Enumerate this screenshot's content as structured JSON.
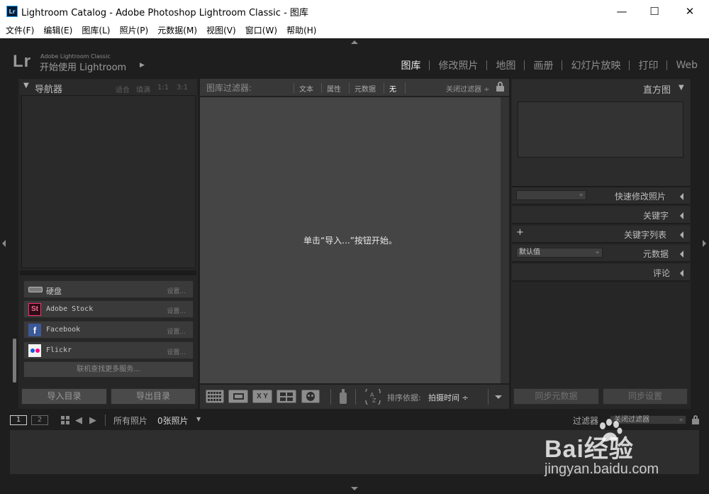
{
  "window": {
    "title": "Lightroom Catalog - Adobe Photoshop Lightroom Classic - 图库",
    "app_icon_text": "Lr",
    "minimize": "—",
    "maximize": "☐",
    "close": "✕"
  },
  "menu": [
    "文件(F)",
    "编辑(E)",
    "图库(L)",
    "照片(P)",
    "元数据(M)",
    "视图(V)",
    "窗口(W)",
    "帮助(H)"
  ],
  "identity": {
    "logo": "Lr",
    "brand_line": "Adobe Lightroom Classic",
    "get_started": "开始使用 Lightroom",
    "arrow": "▶"
  },
  "modules": [
    {
      "label": "图库",
      "active": true
    },
    {
      "label": "修改照片",
      "active": false
    },
    {
      "label": "地图",
      "active": false
    },
    {
      "label": "画册",
      "active": false
    },
    {
      "label": "幻灯片放映",
      "active": false
    },
    {
      "label": "打印",
      "active": false
    },
    {
      "label": "Web",
      "active": false
    }
  ],
  "navigator": {
    "title": "导航器",
    "toggle": "▼",
    "zoom": [
      "适合",
      "填满",
      "1:1",
      "3:1"
    ]
  },
  "publish_services": [
    {
      "name": "硬盘",
      "icon": "hard-drive-icon",
      "action": "设置..."
    },
    {
      "name": "Adobe Stock",
      "icon": "adobe-stock-icon",
      "icon_text": "St",
      "action": "设置..."
    },
    {
      "name": "Facebook",
      "icon": "facebook-icon",
      "icon_text": "f",
      "action": "设置..."
    },
    {
      "name": "Flickr",
      "icon": "flickr-icon",
      "action": "设置..."
    }
  ],
  "find_more_services": "联机查找更多服务...",
  "import_button": "导入目录",
  "export_button": "导出目录",
  "filter_bar": {
    "label": "图库过滤器:",
    "text": "文本",
    "attribute": "属性",
    "metadata": "元数据",
    "none": "无",
    "filters_off": "关闭过滤器 ÷"
  },
  "empty_message": "单击“导入...”按钮开始。",
  "toolbar": {
    "sort_label": "排序依据:",
    "sort_value": "拍摄时间 ÷",
    "xy_label": "X Y"
  },
  "right_panel": {
    "histogram": "histogram",
    "histogram_title": "直方图",
    "quick_develop": "快速修改照片",
    "keywording": "关键字",
    "keyword_list": "关键字列表",
    "metadata": "元数据",
    "metadata_preset": "默认值",
    "comments": "评论",
    "plus": "+",
    "arrow": "◀",
    "sync_metadata": "同步元数据",
    "sync_settings": "同步设置"
  },
  "filmstrip": {
    "view1": "1",
    "view2": "2",
    "source": "所有照片",
    "count": "0张照片",
    "filter_label": "过滤器",
    "filter_value": "关闭过滤器"
  },
  "watermark": {
    "brand": "Bai经验",
    "url": "jingyan.baidu.com"
  },
  "colors": {
    "panel_bg": "#2c2c2c",
    "grid_bg": "#454545",
    "app_bg": "#1e1e1e",
    "active_module": "#e6e6e6"
  }
}
